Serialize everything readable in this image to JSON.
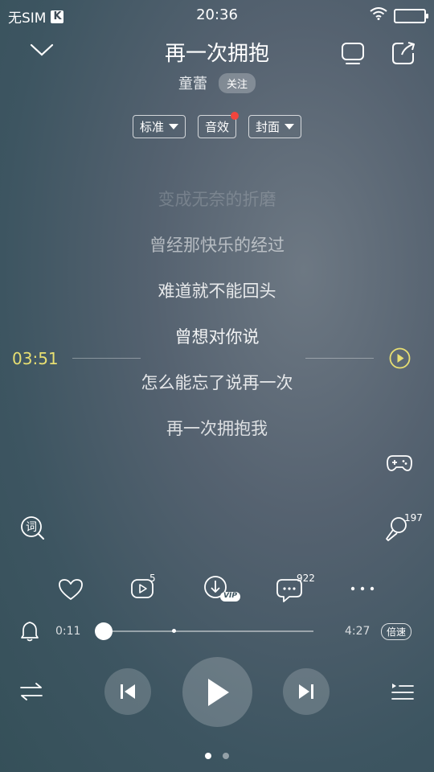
{
  "status_bar": {
    "carrier": "无SIM",
    "carrier_badge": "K",
    "time": "20:36"
  },
  "header": {
    "title": "再一次拥抱",
    "artist": "童蕾",
    "follow_label": "关注"
  },
  "chips": {
    "quality": "标准",
    "sound_effect": "音效",
    "cover": "封面"
  },
  "lyrics": {
    "lines": [
      "变成无奈的折磨",
      "曾经那快乐的经过",
      "难道就不能回头",
      "曾想对你说",
      "怎么能忘了说再一次",
      "再一次拥抱我"
    ],
    "marker_time": "03:51",
    "marker_color": "#e8df72"
  },
  "side": {
    "mic_count": "197"
  },
  "actions": {
    "share_count": "5",
    "comment_count": "922",
    "vip_badge": "VIP"
  },
  "progress": {
    "current": "0:11",
    "total": "4:27",
    "speed_label": "倍速",
    "fraction": 0.04
  },
  "pager": {
    "pages": 2,
    "active": 0
  }
}
